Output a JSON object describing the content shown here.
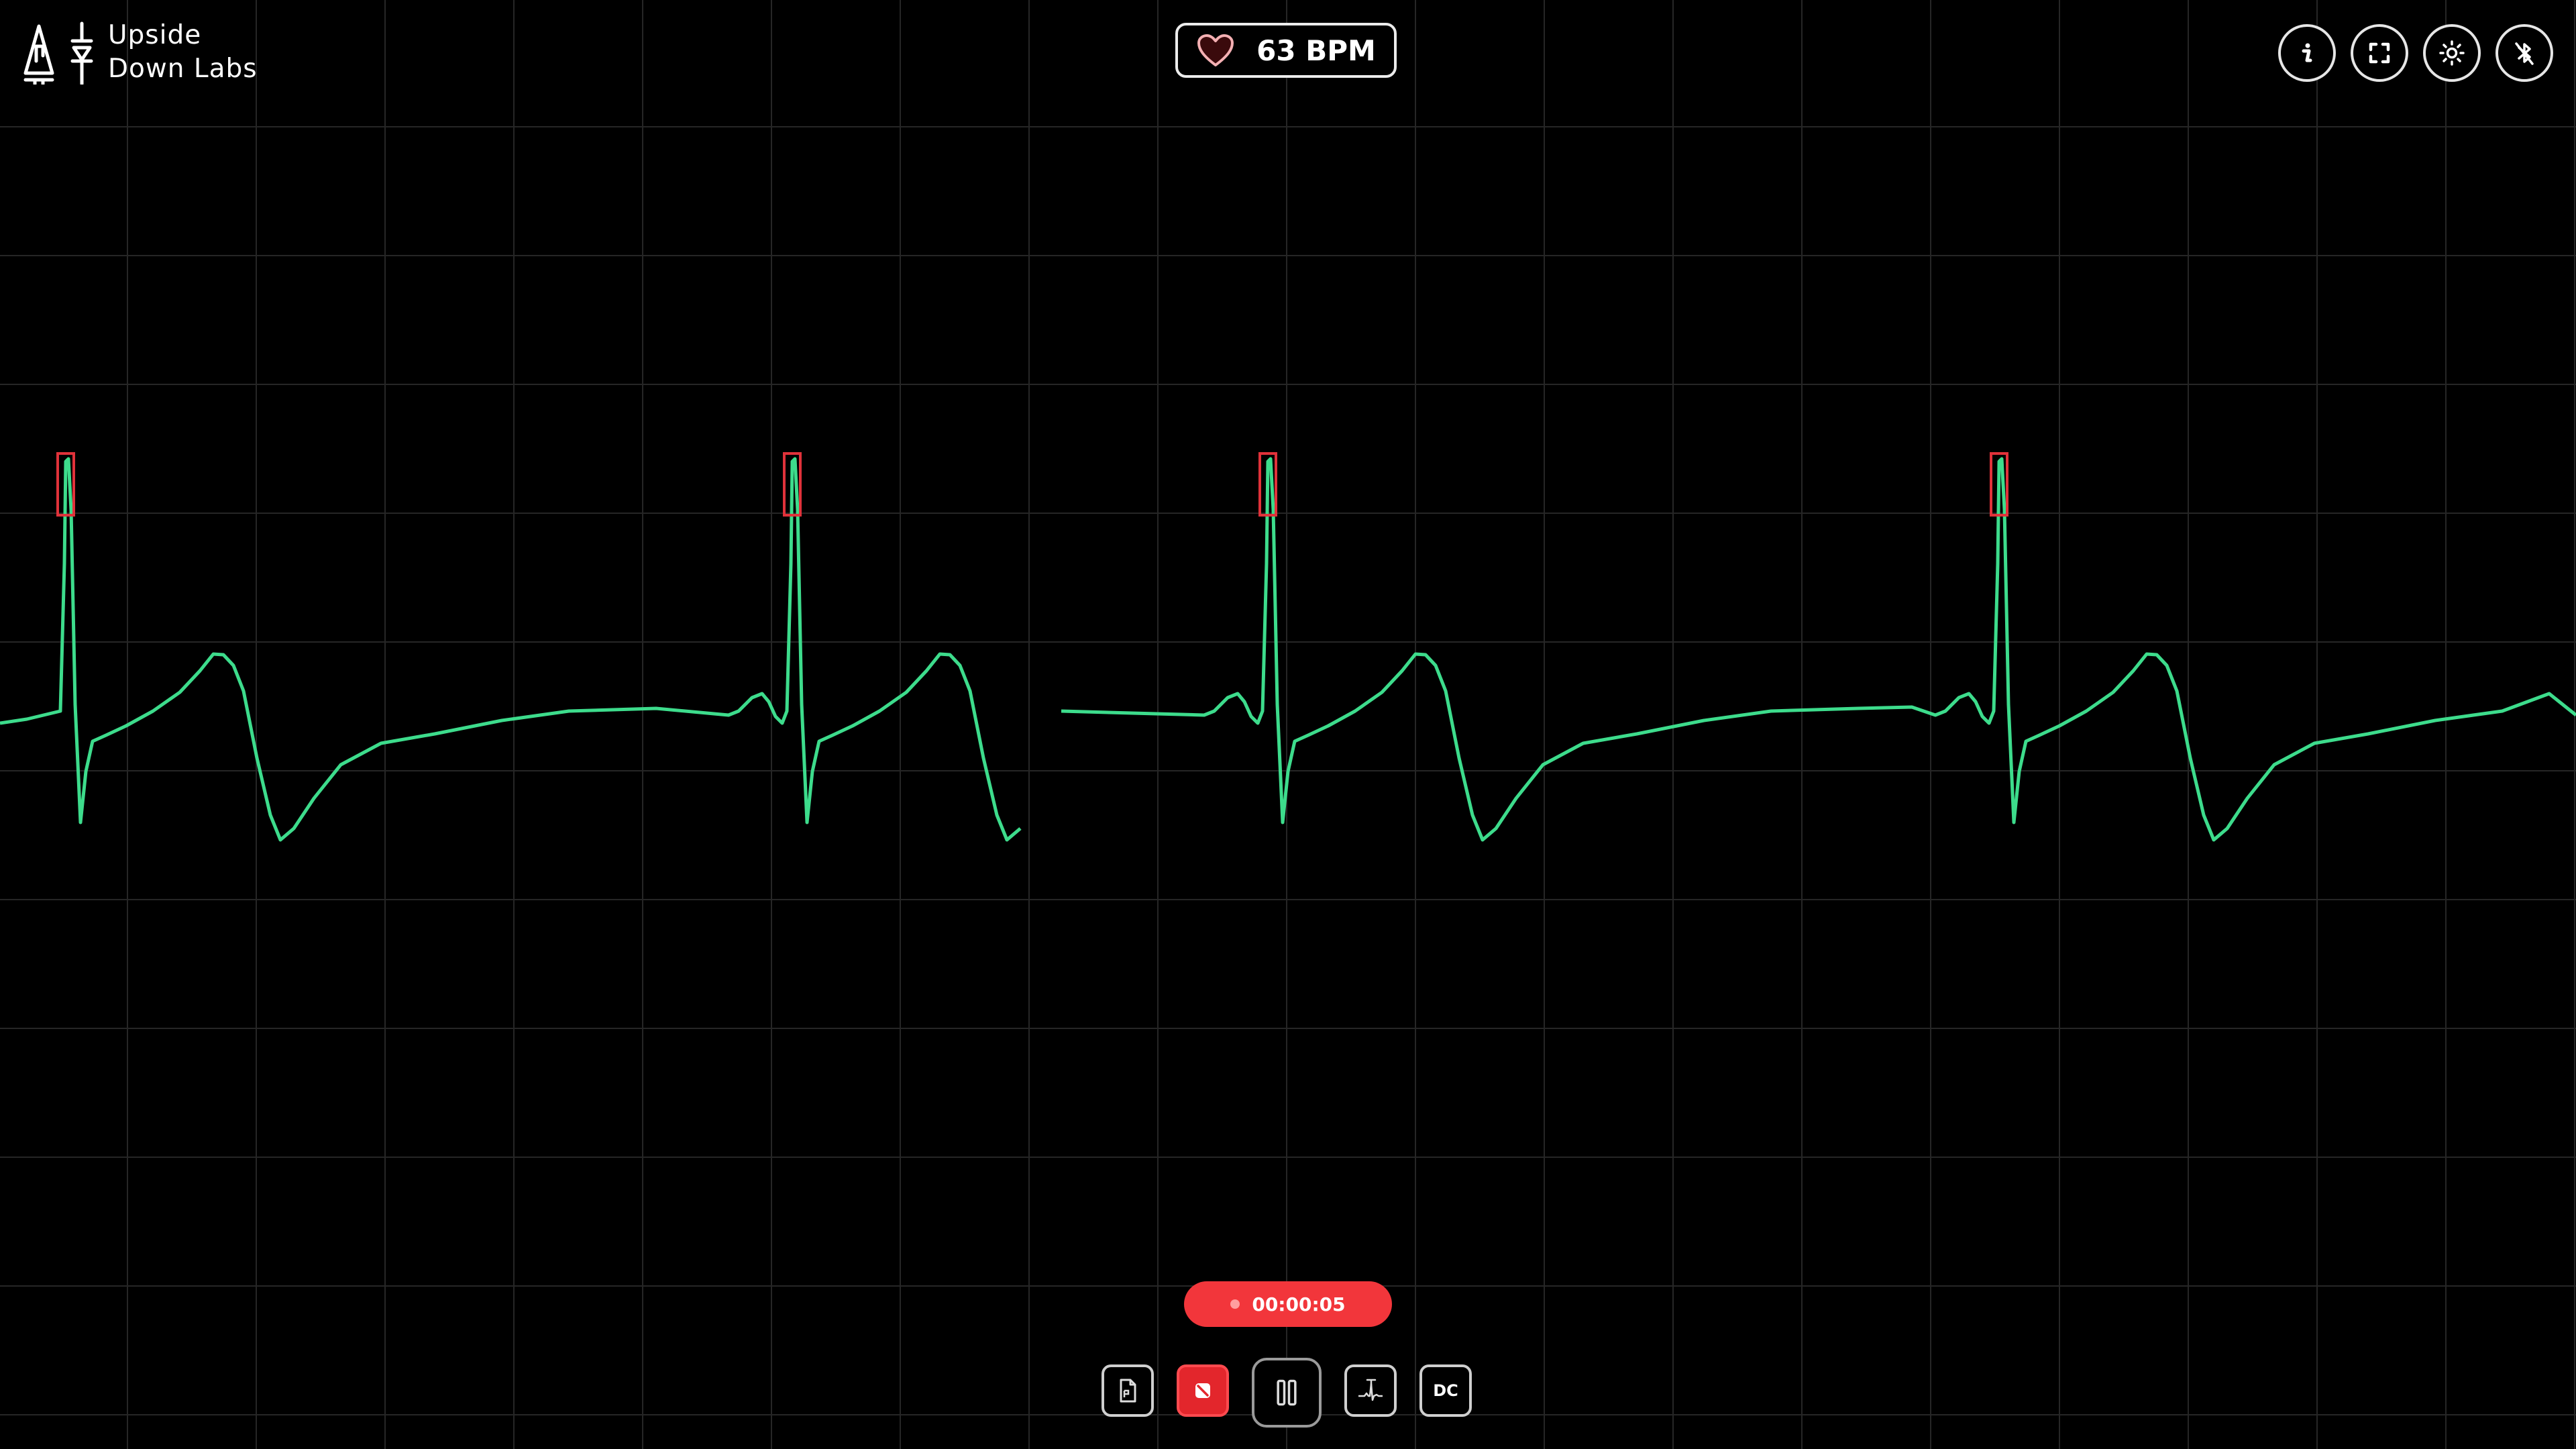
{
  "logo": {
    "line1": "Upside",
    "line2": "Down Labs",
    "icon": "upside-down-labs-logo-icon"
  },
  "heart_rate": {
    "value": "63 BPM",
    "icon": "heart-icon"
  },
  "toolbar_top": {
    "info_icon": "info-icon",
    "fullscreen_icon": "fullscreen-icon",
    "theme_icon": "sun-icon",
    "bluetooth_icon": "bluetooth-off-icon"
  },
  "recording": {
    "time": "00:00:05"
  },
  "toolbar_bottom": {
    "files_icon": "file-icon",
    "record_icon": "record-stop-icon",
    "pause_icon": "pause-icon",
    "filter_icon": "ecg-filter-icon",
    "dc_label": "DC"
  },
  "colors": {
    "background": "#000000",
    "grid": "#262626",
    "trace": "#3ddc8c",
    "peak_marker": "#e0323a",
    "accent_red": "#f2363b"
  }
}
